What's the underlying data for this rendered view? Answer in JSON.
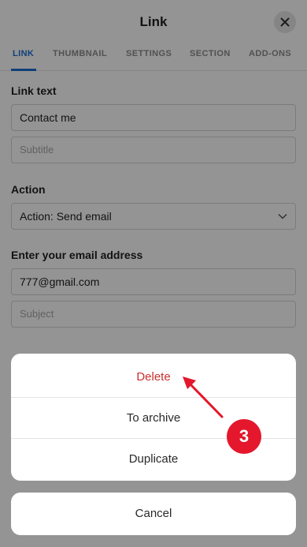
{
  "header": {
    "title": "Link"
  },
  "tabs": [
    {
      "label": "LINK",
      "active": true
    },
    {
      "label": "THUMBNAIL",
      "active": false
    },
    {
      "label": "SETTINGS",
      "active": false
    },
    {
      "label": "SECTION",
      "active": false
    },
    {
      "label": "ADD-ONS",
      "active": false
    }
  ],
  "form": {
    "link_text_label": "Link text",
    "link_text_value": "Contact me",
    "subtitle_placeholder": "Subtitle",
    "action_label": "Action",
    "action_value": "Action: Send email",
    "email_label": "Enter your email address",
    "email_value": "777@gmail.com",
    "subject_placeholder": "Subject"
  },
  "action_sheet": {
    "items": [
      {
        "label": "Delete",
        "style": "danger"
      },
      {
        "label": "To archive",
        "style": "normal"
      },
      {
        "label": "Duplicate",
        "style": "normal"
      }
    ],
    "cancel_label": "Cancel"
  },
  "annotation": {
    "step_number": "3",
    "color": "#e4172c"
  },
  "colors": {
    "accent": "#1e6fd0",
    "danger": "#c8302f",
    "overlay": "rgba(0,0,0,0.42)"
  }
}
